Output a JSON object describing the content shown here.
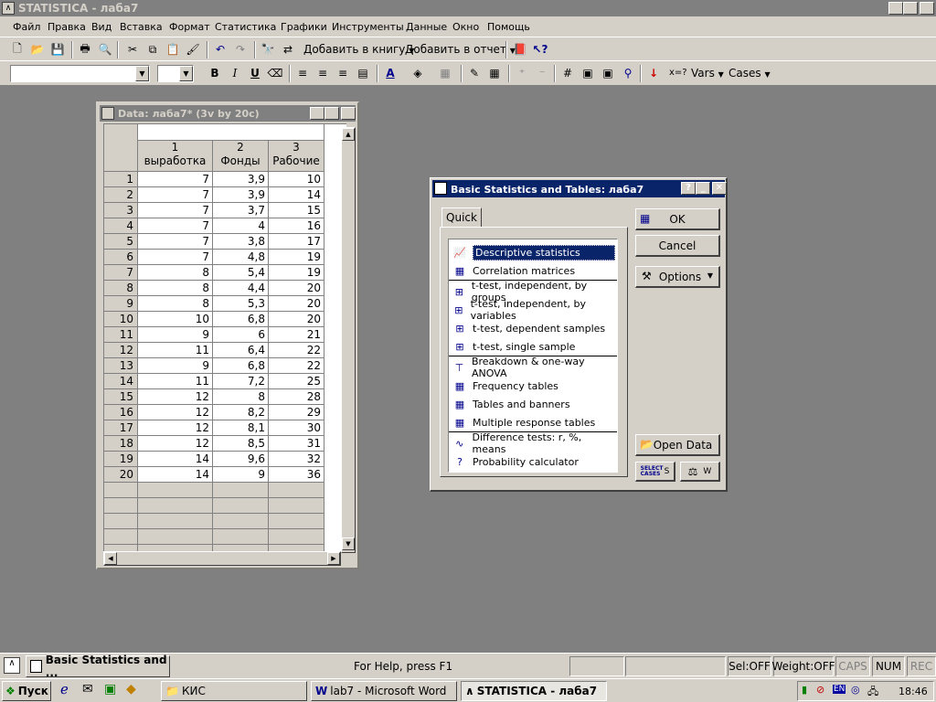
{
  "window": {
    "title": "STATISTICA - лаба7"
  },
  "menu": [
    "Файл",
    "Правка",
    "Вид",
    "Вставка",
    "Формат",
    "Статистика",
    "Графики",
    "Инструменты",
    "Данные",
    "Окно",
    "Помощь"
  ],
  "toolbar": {
    "add_to_book": "Добавить в книгу",
    "add_to_report": "Добавить в отчет",
    "vars": "Vars",
    "cases": "Cases",
    "xeq": "x=?"
  },
  "datawin": {
    "title": "Data: лаба7* (3v by 20c)",
    "columns": [
      {
        "num": "1",
        "name": "выработка"
      },
      {
        "num": "2",
        "name": "Фонды"
      },
      {
        "num": "3",
        "name": "Рабочие"
      }
    ],
    "rows": [
      [
        "1",
        "7",
        "3,9",
        "10"
      ],
      [
        "2",
        "7",
        "3,9",
        "14"
      ],
      [
        "3",
        "7",
        "3,7",
        "15"
      ],
      [
        "4",
        "7",
        "4",
        "16"
      ],
      [
        "5",
        "7",
        "3,8",
        "17"
      ],
      [
        "6",
        "7",
        "4,8",
        "19"
      ],
      [
        "7",
        "8",
        "5,4",
        "19"
      ],
      [
        "8",
        "8",
        "4,4",
        "20"
      ],
      [
        "9",
        "8",
        "5,3",
        "20"
      ],
      [
        "10",
        "10",
        "6,8",
        "20"
      ],
      [
        "11",
        "9",
        "6",
        "21"
      ],
      [
        "12",
        "11",
        "6,4",
        "22"
      ],
      [
        "13",
        "9",
        "6,8",
        "22"
      ],
      [
        "14",
        "11",
        "7,2",
        "25"
      ],
      [
        "15",
        "12",
        "8",
        "28"
      ],
      [
        "16",
        "12",
        "8,2",
        "29"
      ],
      [
        "17",
        "12",
        "8,1",
        "30"
      ],
      [
        "18",
        "12",
        "8,5",
        "31"
      ],
      [
        "19",
        "14",
        "9,6",
        "32"
      ],
      [
        "20",
        "14",
        "9",
        "36"
      ]
    ]
  },
  "dialog": {
    "title": "Basic Statistics and Tables: лаба7",
    "tab": "Quick",
    "items": [
      {
        "label": "Descriptive statistics",
        "icon": "descriptive-icon",
        "selected": true
      },
      {
        "label": "Correlation matrices",
        "icon": "matrix-icon"
      },
      {
        "label": "t-test, independent, by groups",
        "icon": "ttest-icon"
      },
      {
        "label": "t-test, independent, by variables",
        "icon": "ttest-icon"
      },
      {
        "label": "t-test, dependent samples",
        "icon": "ttest-icon"
      },
      {
        "label": "t-test, single sample",
        "icon": "ttest-icon"
      },
      {
        "label": "Breakdown & one-way ANOVA",
        "icon": "breakdown-icon"
      },
      {
        "label": "Frequency tables",
        "icon": "table-icon"
      },
      {
        "label": "Tables and banners",
        "icon": "table-icon"
      },
      {
        "label": "Multiple response tables",
        "icon": "table-icon"
      },
      {
        "label": "Difference tests: r, %, means",
        "icon": "difference-icon"
      },
      {
        "label": "Probability calculator",
        "icon": "calculator-icon"
      }
    ],
    "ok": "OK",
    "cancel": "Cancel",
    "options": "Options",
    "open_data": "Open Data",
    "select_cases": "SELECT CASES",
    "s": "S",
    "w": "W"
  },
  "statusbar": {
    "task": "Basic Statistics and ...",
    "help": "For Help, press F1",
    "sel": "Sel:OFF",
    "weight": "Weight:OFF",
    "caps": "CAPS",
    "num": "NUM",
    "rec": "REC"
  },
  "taskbar": {
    "start": "Пуск",
    "tasks": [
      "КИС",
      "lab7 - Microsoft Word",
      "STATISTICA - лаба7"
    ],
    "tray_lang": "EN",
    "clock": "18:46"
  },
  "colors": {
    "selection": "#0a246a",
    "inactive_title": "#808080",
    "face": "#d4d0c8",
    "workspace": "#808080"
  }
}
